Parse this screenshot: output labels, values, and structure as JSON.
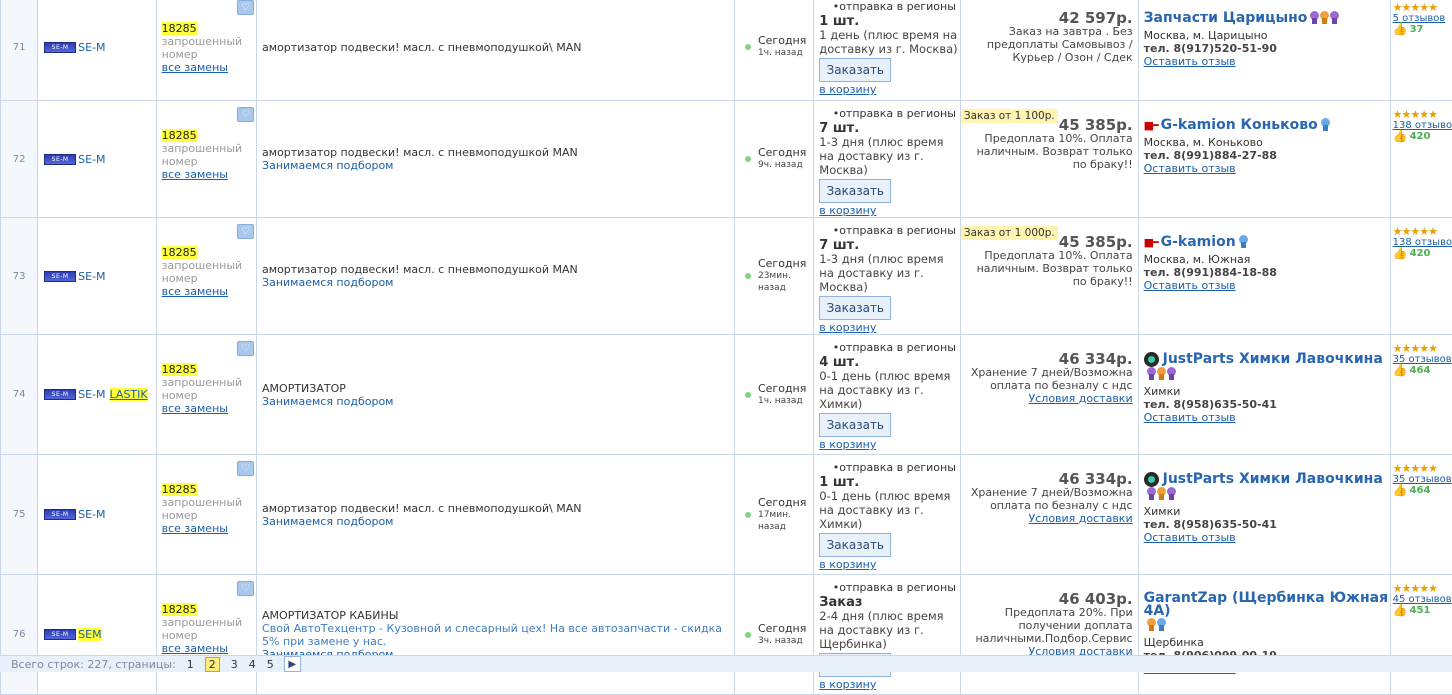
{
  "common": {
    "requested": "запрошенный номер",
    "all_replacements": "все замены",
    "ship_regions": "•отправка в регионы",
    "order_btn": "Заказать",
    "to_cart": "в корзину",
    "leave_review": "Оставить отзыв",
    "selection": "Занимаемся подбором",
    "delivery_terms": "Условия доставки",
    "heart_glyph": "♡",
    "stars": "★★★★★",
    "thumb_glyph": "👍"
  },
  "rows": [
    {
      "idx": "71",
      "brand": "SE-M",
      "brand_extra": "",
      "brand_hl": false,
      "number": "18285",
      "desc": "амортизатор подвески! масл. с пневмоподушкой\\ MAN",
      "desc_note": "",
      "selection": "",
      "date": "Сегодня",
      "ago": "1ч. назад",
      "qty": "1 шт.",
      "days": "1 день (плюс время на доставку из г. Москва)",
      "badge": "",
      "price": "42 597р.",
      "price_note": "Заказ на завтра . Без предоплаты Самовывоз / Курьер / Озон / Сдек",
      "terms": "",
      "seller": "Запчасти Царицыно",
      "seller_icon": "",
      "medals": [
        "purple",
        "orange",
        "purple"
      ],
      "city": "Москва, м. Царицыно",
      "tel": "тел. 8(917)520-51-90",
      "reviews": "5 отзывов",
      "likes": "37"
    },
    {
      "idx": "72",
      "brand": "SE-M",
      "brand_extra": "",
      "brand_hl": false,
      "number": "18285",
      "desc": "амортизатор подвески! масл. с пневмоподушкой MAN",
      "desc_note": "",
      "selection": "Занимаемся подбором",
      "date": "Сегодня",
      "ago": "9ч. назад",
      "qty": "7 шт.",
      "days": "1-3 дня (плюс время на доставку из г. Москва)",
      "badge": "Заказ от 1 100р.",
      "price": "45 385р.",
      "price_note": "Предоплата 10%. Оплата наличным. Возврат только по браку!!",
      "terms": "",
      "seller": "G-kamion Коньково",
      "seller_icon": "gk",
      "medals": [
        "blue"
      ],
      "city": "Москва, м. Коньково",
      "tel": "тел. 8(991)884-27-88",
      "reviews": "138 отзывов",
      "likes": "420"
    },
    {
      "idx": "73",
      "brand": "SE-M",
      "brand_extra": "",
      "brand_hl": false,
      "number": "18285",
      "desc": "амортизатор подвески! масл. с пневмоподушкой MAN",
      "desc_note": "",
      "selection": "Занимаемся подбором",
      "date": "Сегодня",
      "ago": "23мин. назад",
      "qty": "7 шт.",
      "days": "1-3 дня (плюс время на доставку из г. Москва)",
      "badge": "Заказ от 1 000р.",
      "price": "45 385р.",
      "price_note": "Предоплата 10%. Оплата наличным. Возврат только по браку!!",
      "terms": "",
      "seller": "G-kamion",
      "seller_icon": "gk",
      "medals": [
        "blue"
      ],
      "city": "Москва, м. Южная",
      "tel": "тел. 8(991)884-18-88",
      "reviews": "138 отзывов",
      "likes": "420"
    },
    {
      "idx": "74",
      "brand": "SE-M",
      "brand_extra": "LASTIK",
      "brand_hl": false,
      "number": "18285",
      "desc": "АМОРТИЗАТОР",
      "desc_note": "",
      "selection": "Занимаемся подбором",
      "date": "Сегодня",
      "ago": "1ч. назад",
      "qty": "4 шт.",
      "days": "0-1 день (плюс время на доставку из г. Химки)",
      "badge": "",
      "price": "46 334р.",
      "price_note": "Хранение 7 дней/Возможна оплата по безналу с ндс",
      "terms": "Условия доставки",
      "seller": "JustParts Химки Лавочкина",
      "seller_icon": "jp",
      "medals": [
        "purple",
        "orange",
        "purple"
      ],
      "city": "Химки",
      "tel": "тел. 8(958)635-50-41",
      "reviews": "35 отзывов",
      "likes": "464"
    },
    {
      "idx": "75",
      "brand": "SE-M",
      "brand_extra": "",
      "brand_hl": false,
      "number": "18285",
      "desc": "амортизатор подвески! масл. с пневмоподушкой\\ MAN",
      "desc_note": "",
      "selection": "Занимаемся подбором",
      "date": "Сегодня",
      "ago": "17мин. назад",
      "qty": "1 шт.",
      "days": "0-1 день (плюс время на доставку из г. Химки)",
      "badge": "",
      "price": "46 334р.",
      "price_note": "Хранение 7 дней/Возможна оплата по безналу с ндс",
      "terms": "Условия доставки",
      "seller": "JustParts Химки Лавочкина",
      "seller_icon": "jp",
      "medals": [
        "purple",
        "orange",
        "purple"
      ],
      "city": "Химки",
      "tel": "тел. 8(958)635-50-41",
      "reviews": "35 отзывов",
      "likes": "464"
    },
    {
      "idx": "76",
      "brand": "SEM",
      "brand_extra": "",
      "brand_hl": true,
      "number": "18285",
      "desc": "АМОРТИЗАТОР КАБИНЫ",
      "desc_note": "Свой АвтоТехцентр - Кузовной и слесарный цех! На все автозапчасти - скидка 5% при замене у нас.",
      "selection": "Занимаемся подбором",
      "date": "Сегодня",
      "ago": "3ч. назад",
      "qty": "Заказ",
      "days": "2-4 дня (плюс время на доставку из г. Щербинка)",
      "badge": "",
      "price": "46 403р.",
      "price_note": "Предоплата 20%. При получении доплата наличными.Подбор.Сервис",
      "terms": "Условия доставки",
      "seller": "GarantZap (Щербинка Южная 4А)",
      "seller_icon": "",
      "medals": [
        "orange",
        "blue"
      ],
      "city": "Щербинка",
      "tel": "тел. 8(906)099-00-19",
      "reviews": "45 отзывов",
      "likes": "451"
    }
  ],
  "pager": {
    "total": "Всего строк: 227, страницы:",
    "pages": [
      "1",
      "2",
      "3",
      "4",
      "5"
    ],
    "current": "2",
    "next": "▶"
  },
  "colors": {
    "accent": "#1a5fa8",
    "highlight": "#ffff3a",
    "border": "#c9d7e8"
  }
}
